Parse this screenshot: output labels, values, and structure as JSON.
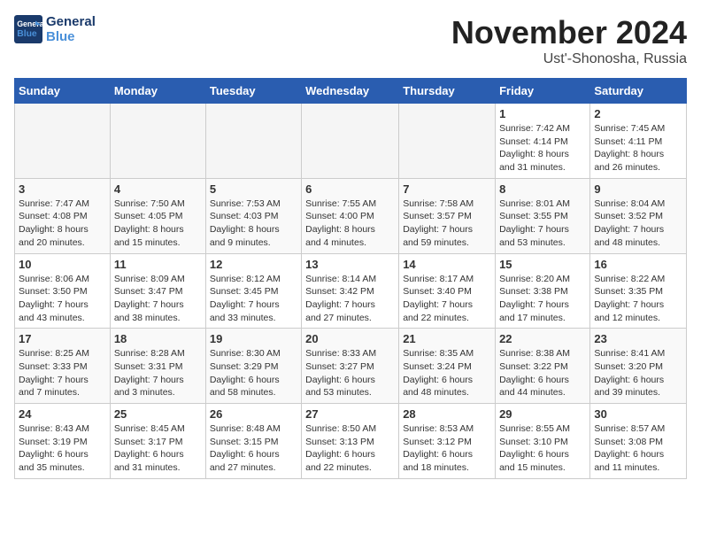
{
  "header": {
    "logo_line1": "General",
    "logo_line2": "Blue",
    "month_title": "November 2024",
    "location": "Ust'-Shonosha, Russia"
  },
  "weekdays": [
    "Sunday",
    "Monday",
    "Tuesday",
    "Wednesday",
    "Thursday",
    "Friday",
    "Saturday"
  ],
  "weeks": [
    [
      {
        "day": "",
        "sunrise": "",
        "sunset": "",
        "daylight": ""
      },
      {
        "day": "",
        "sunrise": "",
        "sunset": "",
        "daylight": ""
      },
      {
        "day": "",
        "sunrise": "",
        "sunset": "",
        "daylight": ""
      },
      {
        "day": "",
        "sunrise": "",
        "sunset": "",
        "daylight": ""
      },
      {
        "day": "",
        "sunrise": "",
        "sunset": "",
        "daylight": ""
      },
      {
        "day": "1",
        "sunrise": "Sunrise: 7:42 AM",
        "sunset": "Sunset: 4:14 PM",
        "daylight": "Daylight: 8 hours and 31 minutes."
      },
      {
        "day": "2",
        "sunrise": "Sunrise: 7:45 AM",
        "sunset": "Sunset: 4:11 PM",
        "daylight": "Daylight: 8 hours and 26 minutes."
      }
    ],
    [
      {
        "day": "3",
        "sunrise": "Sunrise: 7:47 AM",
        "sunset": "Sunset: 4:08 PM",
        "daylight": "Daylight: 8 hours and 20 minutes."
      },
      {
        "day": "4",
        "sunrise": "Sunrise: 7:50 AM",
        "sunset": "Sunset: 4:05 PM",
        "daylight": "Daylight: 8 hours and 15 minutes."
      },
      {
        "day": "5",
        "sunrise": "Sunrise: 7:53 AM",
        "sunset": "Sunset: 4:03 PM",
        "daylight": "Daylight: 8 hours and 9 minutes."
      },
      {
        "day": "6",
        "sunrise": "Sunrise: 7:55 AM",
        "sunset": "Sunset: 4:00 PM",
        "daylight": "Daylight: 8 hours and 4 minutes."
      },
      {
        "day": "7",
        "sunrise": "Sunrise: 7:58 AM",
        "sunset": "Sunset: 3:57 PM",
        "daylight": "Daylight: 7 hours and 59 minutes."
      },
      {
        "day": "8",
        "sunrise": "Sunrise: 8:01 AM",
        "sunset": "Sunset: 3:55 PM",
        "daylight": "Daylight: 7 hours and 53 minutes."
      },
      {
        "day": "9",
        "sunrise": "Sunrise: 8:04 AM",
        "sunset": "Sunset: 3:52 PM",
        "daylight": "Daylight: 7 hours and 48 minutes."
      }
    ],
    [
      {
        "day": "10",
        "sunrise": "Sunrise: 8:06 AM",
        "sunset": "Sunset: 3:50 PM",
        "daylight": "Daylight: 7 hours and 43 minutes."
      },
      {
        "day": "11",
        "sunrise": "Sunrise: 8:09 AM",
        "sunset": "Sunset: 3:47 PM",
        "daylight": "Daylight: 7 hours and 38 minutes."
      },
      {
        "day": "12",
        "sunrise": "Sunrise: 8:12 AM",
        "sunset": "Sunset: 3:45 PM",
        "daylight": "Daylight: 7 hours and 33 minutes."
      },
      {
        "day": "13",
        "sunrise": "Sunrise: 8:14 AM",
        "sunset": "Sunset: 3:42 PM",
        "daylight": "Daylight: 7 hours and 27 minutes."
      },
      {
        "day": "14",
        "sunrise": "Sunrise: 8:17 AM",
        "sunset": "Sunset: 3:40 PM",
        "daylight": "Daylight: 7 hours and 22 minutes."
      },
      {
        "day": "15",
        "sunrise": "Sunrise: 8:20 AM",
        "sunset": "Sunset: 3:38 PM",
        "daylight": "Daylight: 7 hours and 17 minutes."
      },
      {
        "day": "16",
        "sunrise": "Sunrise: 8:22 AM",
        "sunset": "Sunset: 3:35 PM",
        "daylight": "Daylight: 7 hours and 12 minutes."
      }
    ],
    [
      {
        "day": "17",
        "sunrise": "Sunrise: 8:25 AM",
        "sunset": "Sunset: 3:33 PM",
        "daylight": "Daylight: 7 hours and 7 minutes."
      },
      {
        "day": "18",
        "sunrise": "Sunrise: 8:28 AM",
        "sunset": "Sunset: 3:31 PM",
        "daylight": "Daylight: 7 hours and 3 minutes."
      },
      {
        "day": "19",
        "sunrise": "Sunrise: 8:30 AM",
        "sunset": "Sunset: 3:29 PM",
        "daylight": "Daylight: 6 hours and 58 minutes."
      },
      {
        "day": "20",
        "sunrise": "Sunrise: 8:33 AM",
        "sunset": "Sunset: 3:27 PM",
        "daylight": "Daylight: 6 hours and 53 minutes."
      },
      {
        "day": "21",
        "sunrise": "Sunrise: 8:35 AM",
        "sunset": "Sunset: 3:24 PM",
        "daylight": "Daylight: 6 hours and 48 minutes."
      },
      {
        "day": "22",
        "sunrise": "Sunrise: 8:38 AM",
        "sunset": "Sunset: 3:22 PM",
        "daylight": "Daylight: 6 hours and 44 minutes."
      },
      {
        "day": "23",
        "sunrise": "Sunrise: 8:41 AM",
        "sunset": "Sunset: 3:20 PM",
        "daylight": "Daylight: 6 hours and 39 minutes."
      }
    ],
    [
      {
        "day": "24",
        "sunrise": "Sunrise: 8:43 AM",
        "sunset": "Sunset: 3:19 PM",
        "daylight": "Daylight: 6 hours and 35 minutes."
      },
      {
        "day": "25",
        "sunrise": "Sunrise: 8:45 AM",
        "sunset": "Sunset: 3:17 PM",
        "daylight": "Daylight: 6 hours and 31 minutes."
      },
      {
        "day": "26",
        "sunrise": "Sunrise: 8:48 AM",
        "sunset": "Sunset: 3:15 PM",
        "daylight": "Daylight: 6 hours and 27 minutes."
      },
      {
        "day": "27",
        "sunrise": "Sunrise: 8:50 AM",
        "sunset": "Sunset: 3:13 PM",
        "daylight": "Daylight: 6 hours and 22 minutes."
      },
      {
        "day": "28",
        "sunrise": "Sunrise: 8:53 AM",
        "sunset": "Sunset: 3:12 PM",
        "daylight": "Daylight: 6 hours and 18 minutes."
      },
      {
        "day": "29",
        "sunrise": "Sunrise: 8:55 AM",
        "sunset": "Sunset: 3:10 PM",
        "daylight": "Daylight: 6 hours and 15 minutes."
      },
      {
        "day": "30",
        "sunrise": "Sunrise: 8:57 AM",
        "sunset": "Sunset: 3:08 PM",
        "daylight": "Daylight: 6 hours and 11 minutes."
      }
    ]
  ]
}
